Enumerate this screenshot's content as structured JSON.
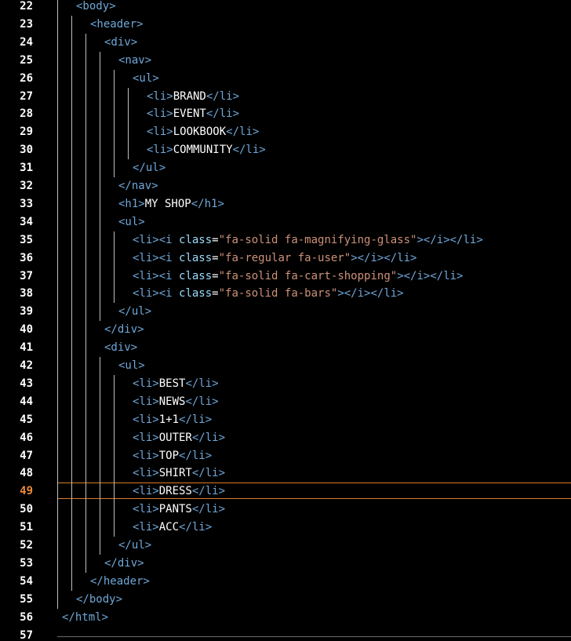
{
  "editor": {
    "current_line": 49,
    "colors": {
      "background": "#000000",
      "tag": "#6ea7d8",
      "attribute": "#9cdcfe",
      "string": "#ce9178",
      "text": "#ffffff",
      "current_line_accent": "#e9893a"
    },
    "lines": [
      {
        "number": "22",
        "indent": 1,
        "tokens": [
          {
            "t": "tag",
            "v": "<body>"
          }
        ]
      },
      {
        "number": "23",
        "indent": 2,
        "tokens": [
          {
            "t": "tag",
            "v": "<header>"
          }
        ]
      },
      {
        "number": "24",
        "indent": 3,
        "tokens": [
          {
            "t": "tag",
            "v": "<div>"
          }
        ]
      },
      {
        "number": "25",
        "indent": 4,
        "tokens": [
          {
            "t": "tag",
            "v": "<nav>"
          }
        ]
      },
      {
        "number": "26",
        "indent": 5,
        "tokens": [
          {
            "t": "tag",
            "v": "<ul>"
          }
        ]
      },
      {
        "number": "27",
        "indent": 6,
        "tokens": [
          {
            "t": "tag",
            "v": "<li>"
          },
          {
            "t": "text",
            "v": "BRAND"
          },
          {
            "t": "tag",
            "v": "</li>"
          }
        ]
      },
      {
        "number": "28",
        "indent": 6,
        "tokens": [
          {
            "t": "tag",
            "v": "<li>"
          },
          {
            "t": "text",
            "v": "EVENT"
          },
          {
            "t": "tag",
            "v": "</li>"
          }
        ]
      },
      {
        "number": "29",
        "indent": 6,
        "tokens": [
          {
            "t": "tag",
            "v": "<li>"
          },
          {
            "t": "text",
            "v": "LOOKBOOK"
          },
          {
            "t": "tag",
            "v": "</li>"
          }
        ]
      },
      {
        "number": "30",
        "indent": 6,
        "tokens": [
          {
            "t": "tag",
            "v": "<li>"
          },
          {
            "t": "text",
            "v": "COMMUNITY"
          },
          {
            "t": "tag",
            "v": "</li>"
          }
        ]
      },
      {
        "number": "31",
        "indent": 5,
        "tokens": [
          {
            "t": "tag",
            "v": "</ul>"
          }
        ]
      },
      {
        "number": "32",
        "indent": 4,
        "tokens": [
          {
            "t": "tag",
            "v": "</nav>"
          }
        ]
      },
      {
        "number": "33",
        "indent": 4,
        "tokens": [
          {
            "t": "tag",
            "v": "<h1>"
          },
          {
            "t": "text",
            "v": "MY SHOP"
          },
          {
            "t": "tag",
            "v": "</h1>"
          }
        ]
      },
      {
        "number": "34",
        "indent": 4,
        "tokens": [
          {
            "t": "tag",
            "v": "<ul>"
          }
        ]
      },
      {
        "number": "35",
        "indent": 5,
        "tokens": [
          {
            "t": "tag",
            "v": "<li><i "
          },
          {
            "t": "attr",
            "v": "class"
          },
          {
            "t": "punct",
            "v": "="
          },
          {
            "t": "str",
            "v": "\"fa-solid fa-magnifying-glass\""
          },
          {
            "t": "tag",
            "v": "></i></li>"
          }
        ]
      },
      {
        "number": "36",
        "indent": 5,
        "tokens": [
          {
            "t": "tag",
            "v": "<li><i "
          },
          {
            "t": "attr",
            "v": "class"
          },
          {
            "t": "punct",
            "v": "="
          },
          {
            "t": "str",
            "v": "\"fa-regular fa-user\""
          },
          {
            "t": "tag",
            "v": "></i></li>"
          }
        ]
      },
      {
        "number": "37",
        "indent": 5,
        "tokens": [
          {
            "t": "tag",
            "v": "<li><i "
          },
          {
            "t": "attr",
            "v": "class"
          },
          {
            "t": "punct",
            "v": "="
          },
          {
            "t": "str",
            "v": "\"fa-solid fa-cart-shopping\""
          },
          {
            "t": "tag",
            "v": "></i></li>"
          }
        ]
      },
      {
        "number": "38",
        "indent": 5,
        "tokens": [
          {
            "t": "tag",
            "v": "<li><i "
          },
          {
            "t": "attr",
            "v": "class"
          },
          {
            "t": "punct",
            "v": "="
          },
          {
            "t": "str",
            "v": "\"fa-solid fa-bars\""
          },
          {
            "t": "tag",
            "v": "></i></li>"
          }
        ]
      },
      {
        "number": "39",
        "indent": 4,
        "tokens": [
          {
            "t": "tag",
            "v": "</ul>"
          }
        ]
      },
      {
        "number": "40",
        "indent": 3,
        "tokens": [
          {
            "t": "tag",
            "v": "</div>"
          }
        ]
      },
      {
        "number": "41",
        "indent": 3,
        "tokens": [
          {
            "t": "tag",
            "v": "<div>"
          }
        ]
      },
      {
        "number": "42",
        "indent": 4,
        "tokens": [
          {
            "t": "tag",
            "v": "<ul>"
          }
        ]
      },
      {
        "number": "43",
        "indent": 5,
        "tokens": [
          {
            "t": "tag",
            "v": "<li>"
          },
          {
            "t": "text",
            "v": "BEST"
          },
          {
            "t": "tag",
            "v": "</li>"
          }
        ]
      },
      {
        "number": "44",
        "indent": 5,
        "tokens": [
          {
            "t": "tag",
            "v": "<li>"
          },
          {
            "t": "text",
            "v": "NEWS"
          },
          {
            "t": "tag",
            "v": "</li>"
          }
        ]
      },
      {
        "number": "45",
        "indent": 5,
        "tokens": [
          {
            "t": "tag",
            "v": "<li>"
          },
          {
            "t": "text",
            "v": "1+1"
          },
          {
            "t": "tag",
            "v": "</li>"
          }
        ]
      },
      {
        "number": "46",
        "indent": 5,
        "tokens": [
          {
            "t": "tag",
            "v": "<li>"
          },
          {
            "t": "text",
            "v": "OUTER"
          },
          {
            "t": "tag",
            "v": "</li>"
          }
        ]
      },
      {
        "number": "47",
        "indent": 5,
        "tokens": [
          {
            "t": "tag",
            "v": "<li>"
          },
          {
            "t": "text",
            "v": "TOP"
          },
          {
            "t": "tag",
            "v": "</li>"
          }
        ]
      },
      {
        "number": "48",
        "indent": 5,
        "tokens": [
          {
            "t": "tag",
            "v": "<li>"
          },
          {
            "t": "text",
            "v": "SHIRT"
          },
          {
            "t": "tag",
            "v": "</li>"
          }
        ]
      },
      {
        "number": "49",
        "indent": 5,
        "tokens": [
          {
            "t": "tag",
            "v": "<li>"
          },
          {
            "t": "text",
            "v": "DRESS"
          },
          {
            "t": "tag",
            "v": "</li>"
          }
        ]
      },
      {
        "number": "50",
        "indent": 5,
        "tokens": [
          {
            "t": "tag",
            "v": "<li>"
          },
          {
            "t": "text",
            "v": "PANTS"
          },
          {
            "t": "tag",
            "v": "</li>"
          }
        ]
      },
      {
        "number": "51",
        "indent": 5,
        "tokens": [
          {
            "t": "tag",
            "v": "<li>"
          },
          {
            "t": "text",
            "v": "ACC"
          },
          {
            "t": "tag",
            "v": "</li>"
          }
        ]
      },
      {
        "number": "52",
        "indent": 4,
        "tokens": [
          {
            "t": "tag",
            "v": "</ul>"
          }
        ]
      },
      {
        "number": "53",
        "indent": 3,
        "tokens": [
          {
            "t": "tag",
            "v": "</div>"
          }
        ]
      },
      {
        "number": "54",
        "indent": 2,
        "tokens": [
          {
            "t": "tag",
            "v": "</header>"
          }
        ]
      },
      {
        "number": "55",
        "indent": 1,
        "tokens": [
          {
            "t": "tag",
            "v": "</body>"
          }
        ]
      },
      {
        "number": "56",
        "indent": 0,
        "tokens": [
          {
            "t": "tag",
            "v": "</html>"
          }
        ]
      },
      {
        "number": "57",
        "indent": 0,
        "tokens": []
      }
    ]
  }
}
